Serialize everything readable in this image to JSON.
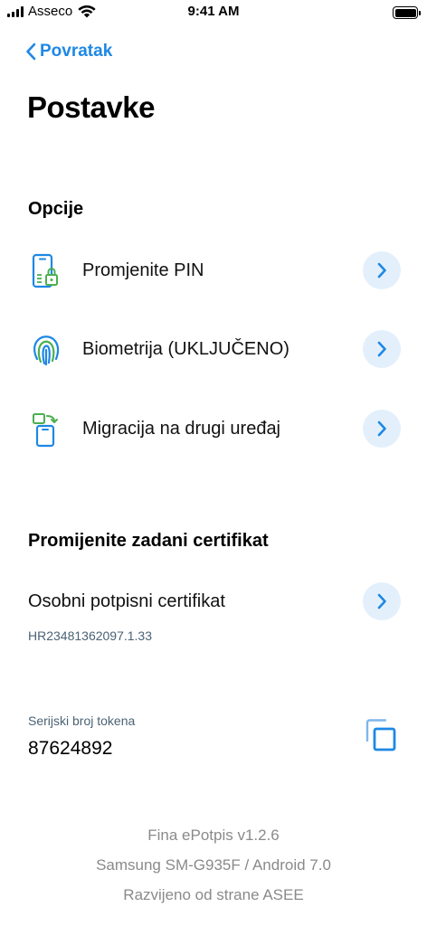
{
  "status_bar": {
    "carrier": "Asseco",
    "time": "9:41 AM",
    "battery_level": 1.0
  },
  "nav": {
    "back_label": "Povratak"
  },
  "page": {
    "title": "Postavke"
  },
  "options": {
    "section_title": "Opcije",
    "items": [
      {
        "label": "Promjenite PIN",
        "icon": "phone-lock-icon"
      },
      {
        "label": "Biometrija (UKLJUČENO)",
        "icon": "fingerprint-icon"
      },
      {
        "label": "Migracija na drugi uređaj",
        "icon": "device-migration-icon"
      }
    ]
  },
  "certificate": {
    "section_title": "Promijenite zadani certifikat",
    "name": "Osobni potpisni certifikat",
    "id": "HR23481362097.1.33"
  },
  "token": {
    "label": "Serijski broj tokena",
    "value": "87624892"
  },
  "footer": {
    "app_version": "Fina ePotpis v1.2.6",
    "device": "Samsung SM-G935F / Android 7.0",
    "developer": "Razvijeno od strane  ASEE"
  },
  "colors": {
    "accent": "#1e88e5",
    "icon_green": "#4caf50",
    "chevron_bg": "#e3f0fc",
    "muted_text": "#8a8a8a",
    "secondary_text": "#4a6274"
  }
}
